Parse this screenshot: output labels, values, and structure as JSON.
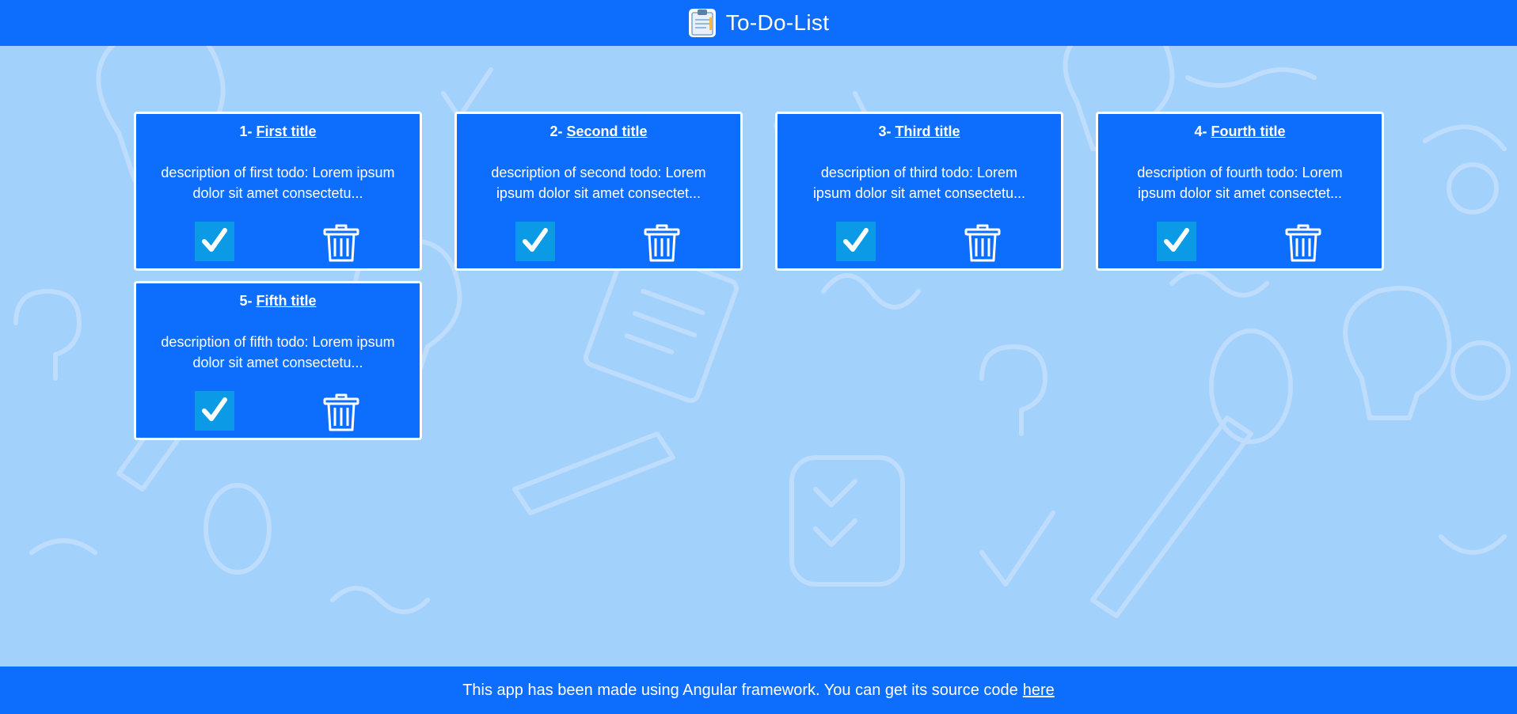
{
  "header": {
    "title": "To-Do-List",
    "logo_icon": "clipboard-icon"
  },
  "todos": [
    {
      "number": "1-",
      "title": "First title",
      "description": "description of first todo: Lorem ipsum dolor sit amet consectetu..."
    },
    {
      "number": "2-",
      "title": "Second title",
      "description": "description of second todo: Lorem ipsum dolor sit amet consectet..."
    },
    {
      "number": "3-",
      "title": "Third title",
      "description": "description of third todo: Lorem ipsum dolor sit amet consectetu..."
    },
    {
      "number": "4-",
      "title": "Fourth title",
      "description": "description of fourth todo: Lorem ipsum dolor sit amet consectet..."
    },
    {
      "number": "5-",
      "title": "Fifth title",
      "description": "description of fifth todo: Lorem ipsum dolor sit amet consectetu..."
    }
  ],
  "card_actions": {
    "done_icon": "checkmark-icon",
    "delete_icon": "trash-icon"
  },
  "footer": {
    "text": "This app has been made using Angular framework. You can get its source code",
    "link_label": "here"
  },
  "colors": {
    "primary": "#0d6efd",
    "background": "#a2d1fc",
    "done_button": "#0b9be6",
    "card_border": "#ffffff"
  }
}
